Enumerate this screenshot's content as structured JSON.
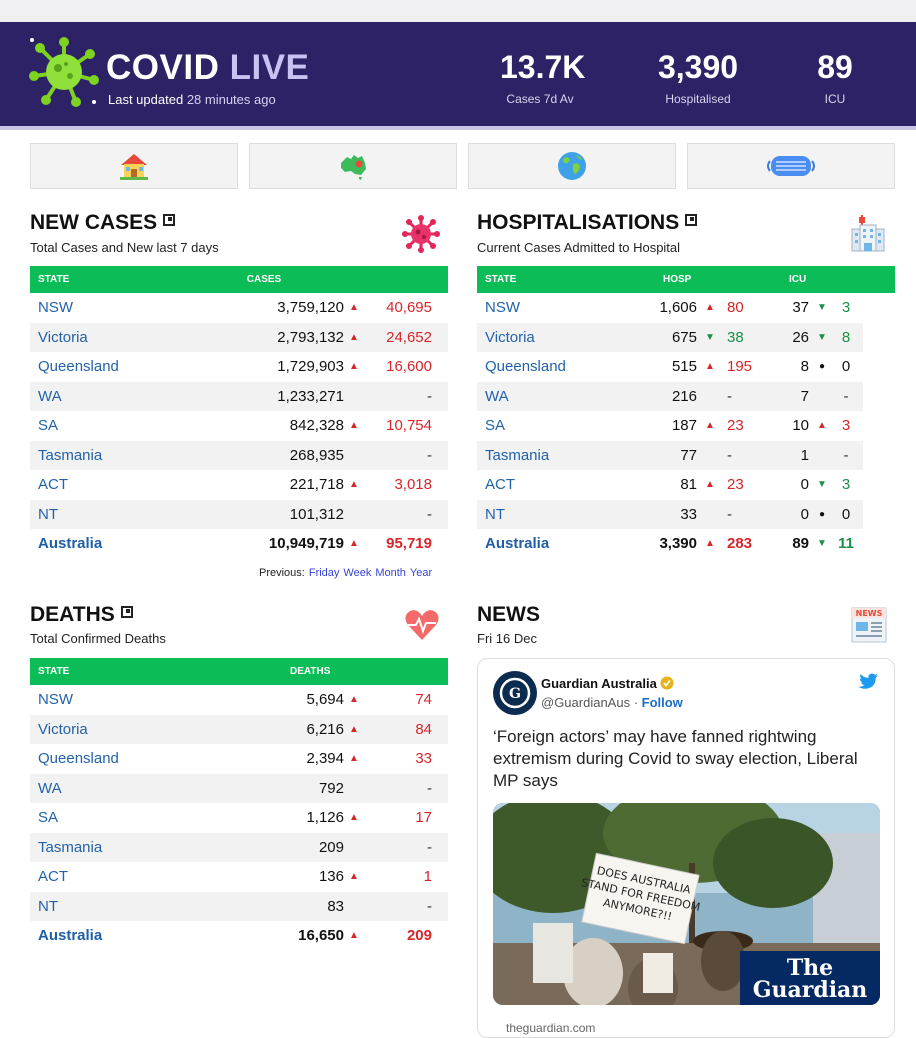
{
  "header": {
    "brand_main": "COVID",
    "brand_live": "LIVE",
    "updated_label": "Last updated",
    "updated_ago": "28 minutes ago",
    "stats": [
      {
        "value": "13.7K",
        "label": "Cases 7d Av"
      },
      {
        "value": "3,390",
        "label": "Hospitalised"
      },
      {
        "value": "89",
        "label": "ICU"
      }
    ]
  },
  "nav": [
    "home-icon",
    "australia-map-icon",
    "globe-icon",
    "face-mask-icon"
  ],
  "new_cases": {
    "title": "NEW CASES",
    "subtitle": "Total Cases and New last 7 days",
    "col_state": "STATE",
    "col_cases": "CASES",
    "rows": [
      {
        "state": "NSW",
        "cases": "3,759,120",
        "dir": "▲",
        "change": "40,695"
      },
      {
        "state": "Victoria",
        "cases": "2,793,132",
        "dir": "▲",
        "change": "24,652"
      },
      {
        "state": "Queensland",
        "cases": "1,729,903",
        "dir": "▲",
        "change": "16,600"
      },
      {
        "state": "WA",
        "cases": "1,233,271",
        "dir": "",
        "change": "-"
      },
      {
        "state": "SA",
        "cases": "842,328",
        "dir": "▲",
        "change": "10,754"
      },
      {
        "state": "Tasmania",
        "cases": "268,935",
        "dir": "",
        "change": "-"
      },
      {
        "state": "ACT",
        "cases": "221,718",
        "dir": "▲",
        "change": "3,018"
      },
      {
        "state": "NT",
        "cases": "101,312",
        "dir": "",
        "change": "-"
      },
      {
        "state": "Australia",
        "cases": "10,949,719",
        "dir": "▲",
        "change": "95,719"
      }
    ],
    "previous_label": "Previous:",
    "previous_links": [
      "Friday",
      "Week",
      "Month",
      "Year"
    ]
  },
  "hospitalisations": {
    "title": "HOSPITALISATIONS",
    "subtitle": "Current Cases Admitted to Hospital",
    "col_state": "STATE",
    "col_hosp": "HOSP",
    "col_icu": "ICU",
    "rows": [
      {
        "state": "NSW",
        "hosp": "1,606",
        "hdir": "▲",
        "hchg": "80",
        "icu": "37",
        "idir": "▼",
        "ichg": "3"
      },
      {
        "state": "Victoria",
        "hosp": "675",
        "hdir": "▼",
        "hchg": "38",
        "icu": "26",
        "idir": "▼",
        "ichg": "8"
      },
      {
        "state": "Queensland",
        "hosp": "515",
        "hdir": "▲",
        "hchg": "195",
        "icu": "8",
        "idir": "●",
        "ichg": "0"
      },
      {
        "state": "WA",
        "hosp": "216",
        "hdir": "",
        "hchg": "-",
        "icu": "7",
        "idir": "",
        "ichg": "-"
      },
      {
        "state": "SA",
        "hosp": "187",
        "hdir": "▲",
        "hchg": "23",
        "icu": "10",
        "idir": "▲",
        "ichg": "3"
      },
      {
        "state": "Tasmania",
        "hosp": "77",
        "hdir": "",
        "hchg": "-",
        "icu": "1",
        "idir": "",
        "ichg": "-"
      },
      {
        "state": "ACT",
        "hosp": "81",
        "hdir": "▲",
        "hchg": "23",
        "icu": "0",
        "idir": "▼",
        "ichg": "3"
      },
      {
        "state": "NT",
        "hosp": "33",
        "hdir": "",
        "hchg": "-",
        "icu": "0",
        "idir": "●",
        "ichg": "0"
      },
      {
        "state": "Australia",
        "hosp": "3,390",
        "hdir": "▲",
        "hchg": "283",
        "icu": "89",
        "idir": "▼",
        "ichg": "11"
      }
    ]
  },
  "deaths": {
    "title": "DEATHS",
    "subtitle": "Total Confirmed Deaths",
    "col_state": "STATE",
    "col_deaths": "DEATHS",
    "rows": [
      {
        "state": "NSW",
        "deaths": "5,694",
        "dir": "▲",
        "change": "74"
      },
      {
        "state": "Victoria",
        "deaths": "6,216",
        "dir": "▲",
        "change": "84"
      },
      {
        "state": "Queensland",
        "deaths": "2,394",
        "dir": "▲",
        "change": "33"
      },
      {
        "state": "WA",
        "deaths": "792",
        "dir": "",
        "change": "-"
      },
      {
        "state": "SA",
        "deaths": "1,126",
        "dir": "▲",
        "change": "17"
      },
      {
        "state": "Tasmania",
        "deaths": "209",
        "dir": "",
        "change": "-"
      },
      {
        "state": "ACT",
        "deaths": "136",
        "dir": "▲",
        "change": "1"
      },
      {
        "state": "NT",
        "deaths": "83",
        "dir": "",
        "change": "-"
      },
      {
        "state": "Australia",
        "deaths": "16,650",
        "dir": "▲",
        "change": "209"
      }
    ]
  },
  "news": {
    "title": "NEWS",
    "date": "Fri 16 Dec",
    "tweet": {
      "name": "Guardian Australia",
      "handle": "@GuardianAus",
      "follow": "Follow",
      "text": "‘Foreign actors’ may have fanned rightwing extremism during Covid to sway election, Liberal MP says",
      "sign_text": "DOES AUSTRALIA STAND FOR FREEDOM ANYMORE?!!",
      "watermark_1": "The",
      "watermark_2": "Guardian",
      "domain": "theguardian.com"
    }
  },
  "colors": {
    "header_bg": "#2c2265",
    "table_header": "#0cbc57",
    "state_link": "#2262a9",
    "increase": "#d4262b",
    "decrease": "#1a8f46"
  }
}
